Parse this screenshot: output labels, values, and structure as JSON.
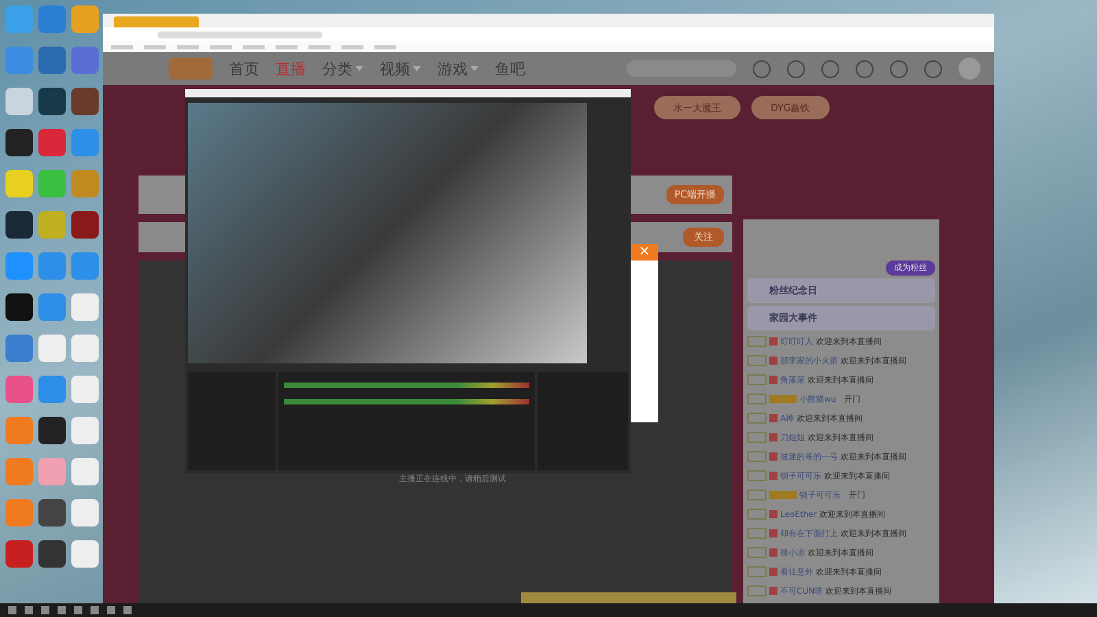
{
  "site": {
    "nav": [
      {
        "label": "首页",
        "selected": false,
        "has_menu": false
      },
      {
        "label": "直播",
        "selected": true,
        "has_menu": false
      },
      {
        "label": "分类",
        "selected": false,
        "has_menu": true
      },
      {
        "label": "视频",
        "selected": false,
        "has_menu": true
      },
      {
        "label": "游戏",
        "selected": false,
        "has_menu": true
      },
      {
        "label": "鱼吧",
        "selected": false,
        "has_menu": false
      }
    ],
    "tags": [
      "水一大魔王",
      "DYG鑫铁"
    ],
    "pc_button": "PC端开播",
    "follow_button": "关注"
  },
  "chat": {
    "fan_button": "成为粉丝",
    "cards": [
      "粉丝纪念日",
      "家园大事件"
    ],
    "messages": [
      {
        "kind": "welcome",
        "user": "叮叮叮人",
        "text": "欢迎来到本直播间"
      },
      {
        "kind": "welcome",
        "user": "那李家的小火苗",
        "text": "欢迎来到本直播间"
      },
      {
        "kind": "welcome",
        "user": "角落菜",
        "text": "欢迎来到本直播间"
      },
      {
        "kind": "enter",
        "user": "小熊猫wu",
        "text": "开门"
      },
      {
        "kind": "welcome",
        "user": "A神",
        "text": "欢迎来到本直播间"
      },
      {
        "kind": "welcome",
        "user": "刀姐姐",
        "text": "欢迎来到本直播间"
      },
      {
        "kind": "welcome",
        "user": "彼迷的哥的一号",
        "text": "欢迎来到本直播间"
      },
      {
        "kind": "welcome",
        "user": "锁子可可乐",
        "text": "欢迎来到本直播间"
      },
      {
        "kind": "enter",
        "user": "锁子可可乐",
        "text": "开门"
      },
      {
        "kind": "welcome",
        "user": "LeoEther",
        "text": "欢迎来到本直播间"
      },
      {
        "kind": "welcome",
        "user": "却有在下面打上",
        "text": "欢迎来到本直播间"
      },
      {
        "kind": "welcome",
        "user": "辣小凉",
        "text": "欢迎来到本直播间"
      },
      {
        "kind": "welcome",
        "user": "看往意外",
        "text": "欢迎来到本直播间"
      },
      {
        "kind": "welcome",
        "user": "不可CUN嘻",
        "text": "欢迎来到本直播间"
      }
    ]
  },
  "player": {
    "status": "主播正在连线中，请稍后测试"
  },
  "popup": {
    "close": "×"
  }
}
